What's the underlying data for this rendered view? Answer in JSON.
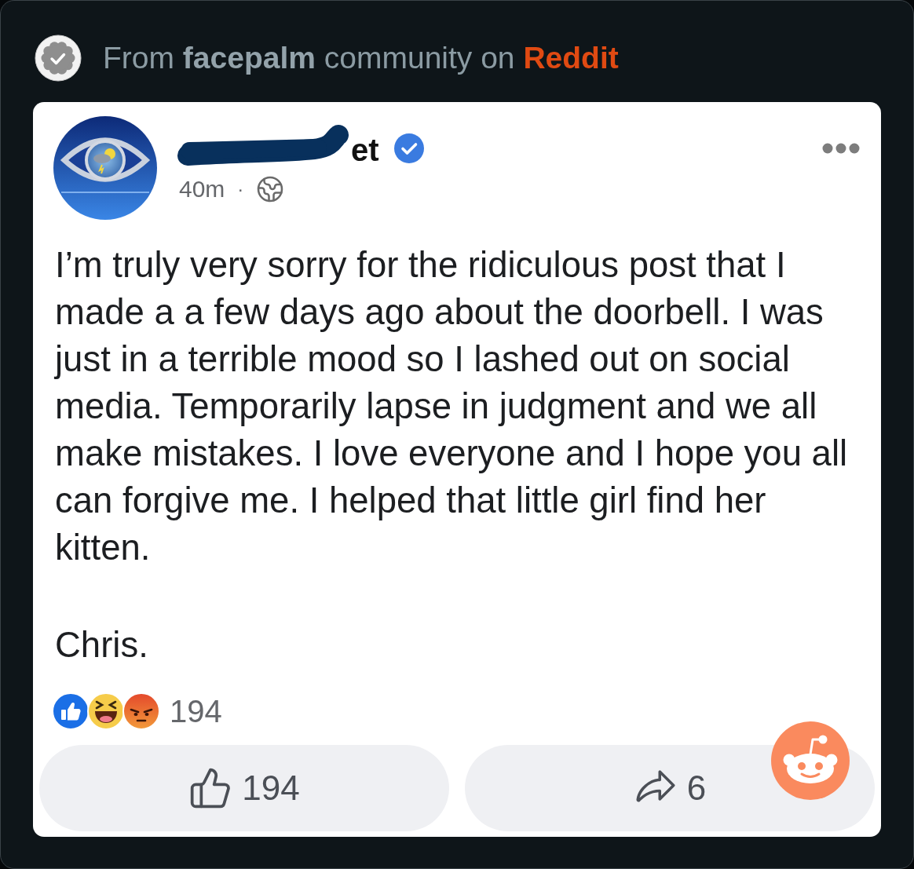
{
  "source": {
    "text_before": "From",
    "community": "facepalm",
    "text_middle": "community on",
    "platform": "Reddit"
  },
  "post": {
    "author_fragment": "et",
    "verified": true,
    "time": "40m",
    "separator": "·",
    "paragraphs": [
      "I’m truly very sorry for the ridiculous post that I made a a few days ago about the doorbell. I was just in a terrible mood so I lashed out on social media. Temporarily lapse in judgment and we all make mistakes. I love everyone and I hope you all can forgive me. I helped that little girl find her kitten.",
      "Chris."
    ]
  },
  "reactions": {
    "kinds": [
      {
        "kind": "like"
      },
      {
        "kind": "haha"
      },
      {
        "kind": "angry"
      }
    ],
    "count": "194"
  },
  "actions": [
    {
      "kind": "like",
      "count": "194"
    },
    {
      "kind": "share",
      "count": "6"
    }
  ]
}
